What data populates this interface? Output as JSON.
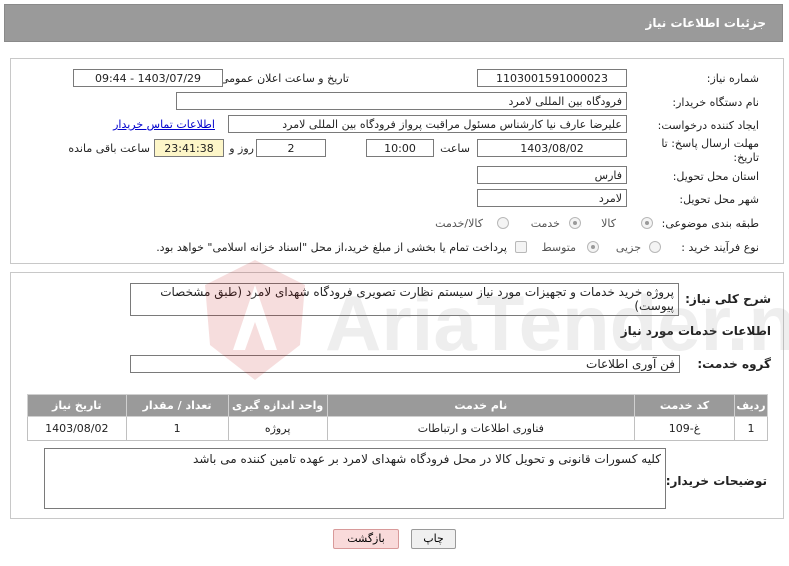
{
  "header": {
    "title": "جزئیات اطلاعات نیاز"
  },
  "info": {
    "need_number_label": "شماره نیاز:",
    "need_number": "1103001591000023",
    "announce_label": "تاریخ و ساعت اعلان عمومی:",
    "announce_value": "1403/07/29 - 09:44",
    "buyer_org_label": "نام دستگاه خریدار:",
    "buyer_org": "فرودگاه بین المللی لامرد",
    "creator_label": "ایجاد کننده درخواست:",
    "creator": "علیرضا عارف نیا کارشناس مسئول مراقبت پرواز فرودگاه بین المللی لامرد",
    "contact_link": "اطلاعات تماس خریدار",
    "deadline_label": "مهلت ارسال پاسخ: تا تاریخ:",
    "deadline_date": "1403/08/02",
    "time_label": "ساعت",
    "deadline_time": "10:00",
    "days_value": "2",
    "days_label": "روز و",
    "remaining_time": "23:41:38",
    "remaining_label": "ساعت باقی مانده",
    "province_label": "استان محل تحویل:",
    "province": "فارس",
    "city_label": "شهر محل تحویل:",
    "city": "لامرد",
    "category_label": "طبقه بندی موضوعی:",
    "category_options": [
      "کالا",
      "خدمت",
      "کالا/خدمت"
    ],
    "process_label": "نوع فرآیند خرید :",
    "process_options": [
      "جزیی",
      "متوسط"
    ],
    "payment_note": "پرداخت تمام یا بخشی از مبلغ خرید،از محل \"اسناد خزانه اسلامی\" خواهد بود."
  },
  "summary": {
    "label": "شرح کلی نیاز:",
    "text": "پروژه  خرید خدمات و تجهیزات مورد نیاز سیستم نظارت تصویری فرودگاه شهدای لامرد (طبق مشخصات پیوست)"
  },
  "services": {
    "section_title": "اطلاعات خدمات مورد نیاز",
    "group_label": "گروه خدمت:",
    "group_value": "فن آوری اطلاعات",
    "columns": [
      "ردیف",
      "کد خدمت",
      "نام خدمت",
      "واحد اندازه گیری",
      "تعداد / مقدار",
      "تاریخ نیاز"
    ],
    "rows": [
      [
        "1",
        "غ-109",
        "فناوری اطلاعات و ارتباطات",
        "پروژه",
        "1",
        "1403/08/02"
      ]
    ]
  },
  "buyer_notes": {
    "label": "توضیحات خریدار:",
    "text": "کلیه کسورات قانونی و تحویل کالا در محل فرودگاه شهدای لامرد بر عهده تامین کننده می باشد"
  },
  "buttons": {
    "print": "چاپ",
    "back": "بازگشت"
  },
  "watermark": {
    "text": "AriaTender.net"
  },
  "colors": {
    "header_bg": "#9a9a9a",
    "link": "#0000cc",
    "remaining_bg": "#fdf6c8",
    "back_bg": "#f9dada"
  }
}
